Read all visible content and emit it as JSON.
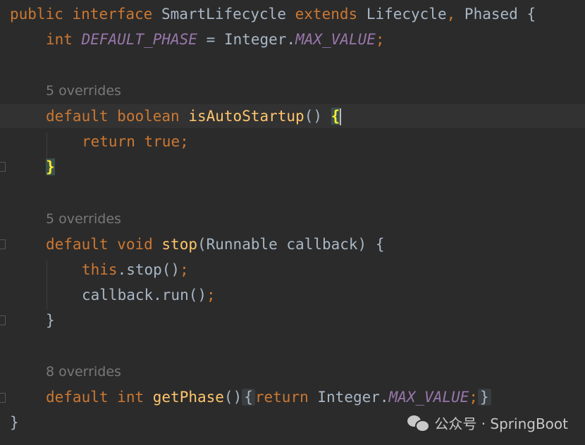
{
  "code": {
    "l1": {
      "public": "public",
      "interface": "interface",
      "name": "SmartLifecycle",
      "extends": "extends",
      "parent1": "Lifecycle",
      "comma": ",",
      "parent2": "Phased",
      "brace": "{"
    },
    "l2": {
      "type": "int",
      "const": "DEFAULT_PHASE",
      "eq": "=",
      "cls": "Integer",
      "dot": ".",
      "value": "MAX_VALUE",
      "semi": ";"
    },
    "hint1": "5 overrides",
    "l4": {
      "default": "default",
      "type": "boolean",
      "method": "isAutoStartup",
      "parens": "()",
      "brace": "{"
    },
    "l5": {
      "ret": "return",
      "val": "true",
      "semi": ";"
    },
    "l6": {
      "brace": "}"
    },
    "hint2": "5 overrides",
    "l8": {
      "default": "default",
      "type": "void",
      "method": "stop",
      "params": "(Runnable callback)",
      "brace": "{"
    },
    "l9": {
      "this": "this",
      "call": ".stop()",
      "semi": ";"
    },
    "l10": {
      "call": "callback.run()",
      "semi": ";"
    },
    "l11": {
      "brace": "}"
    },
    "hint3": "8 overrides",
    "l13": {
      "default": "default",
      "type": "int",
      "method": "getPhase",
      "parens": "()",
      "open": "{",
      "ret": "return",
      "cls": "Integer",
      "dot": ".",
      "value": "MAX_VALUE",
      "semi": ";",
      "close": "}"
    },
    "l14": {
      "brace": "}"
    }
  },
  "watermark": {
    "text": "公众号 · SpringBoot",
    "icon": "wechat-icon"
  },
  "colors": {
    "background": "#2b2b2b",
    "keyword": "#cc7832",
    "method": "#ffc66d",
    "constant": "#9876aa",
    "text": "#a9b7c6",
    "hint": "#787878"
  }
}
